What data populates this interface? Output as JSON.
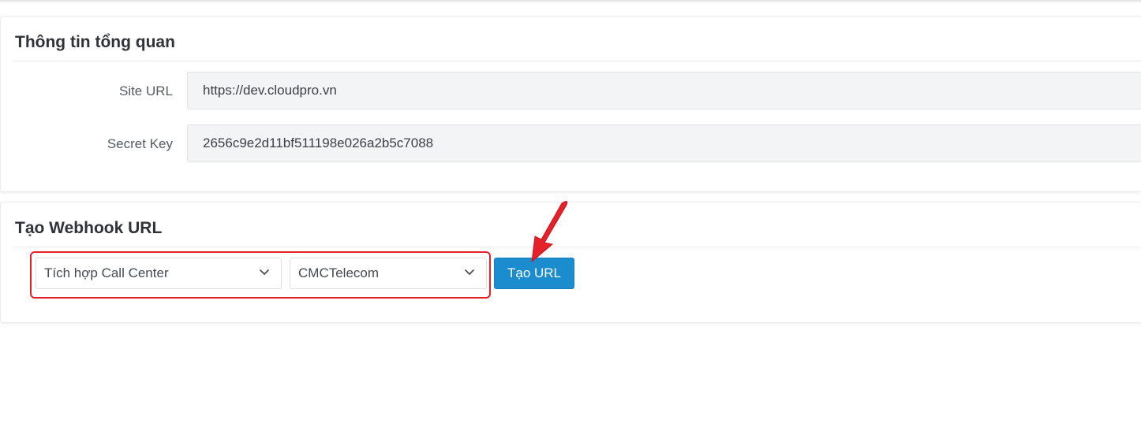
{
  "overview": {
    "title": "Thông tin tổng quan",
    "site_url_label": "Site URL",
    "site_url_value": "https://dev.cloudpro.vn",
    "secret_key_label": "Secret Key",
    "secret_key_value": "2656c9e2d11bf511198e026a2b5c7088"
  },
  "webhook": {
    "title": "Tạo Webhook URL",
    "integration_select": "Tích hợp Call Center",
    "provider_select": "CMCTelecom",
    "create_button": "Tạo URL"
  },
  "colors": {
    "primary_button": "#1b8ccd",
    "annotation_red": "#e5212a"
  },
  "icons": {
    "select_chevron": "chevron-down-icon",
    "annotation": "red-arrow-icon"
  }
}
